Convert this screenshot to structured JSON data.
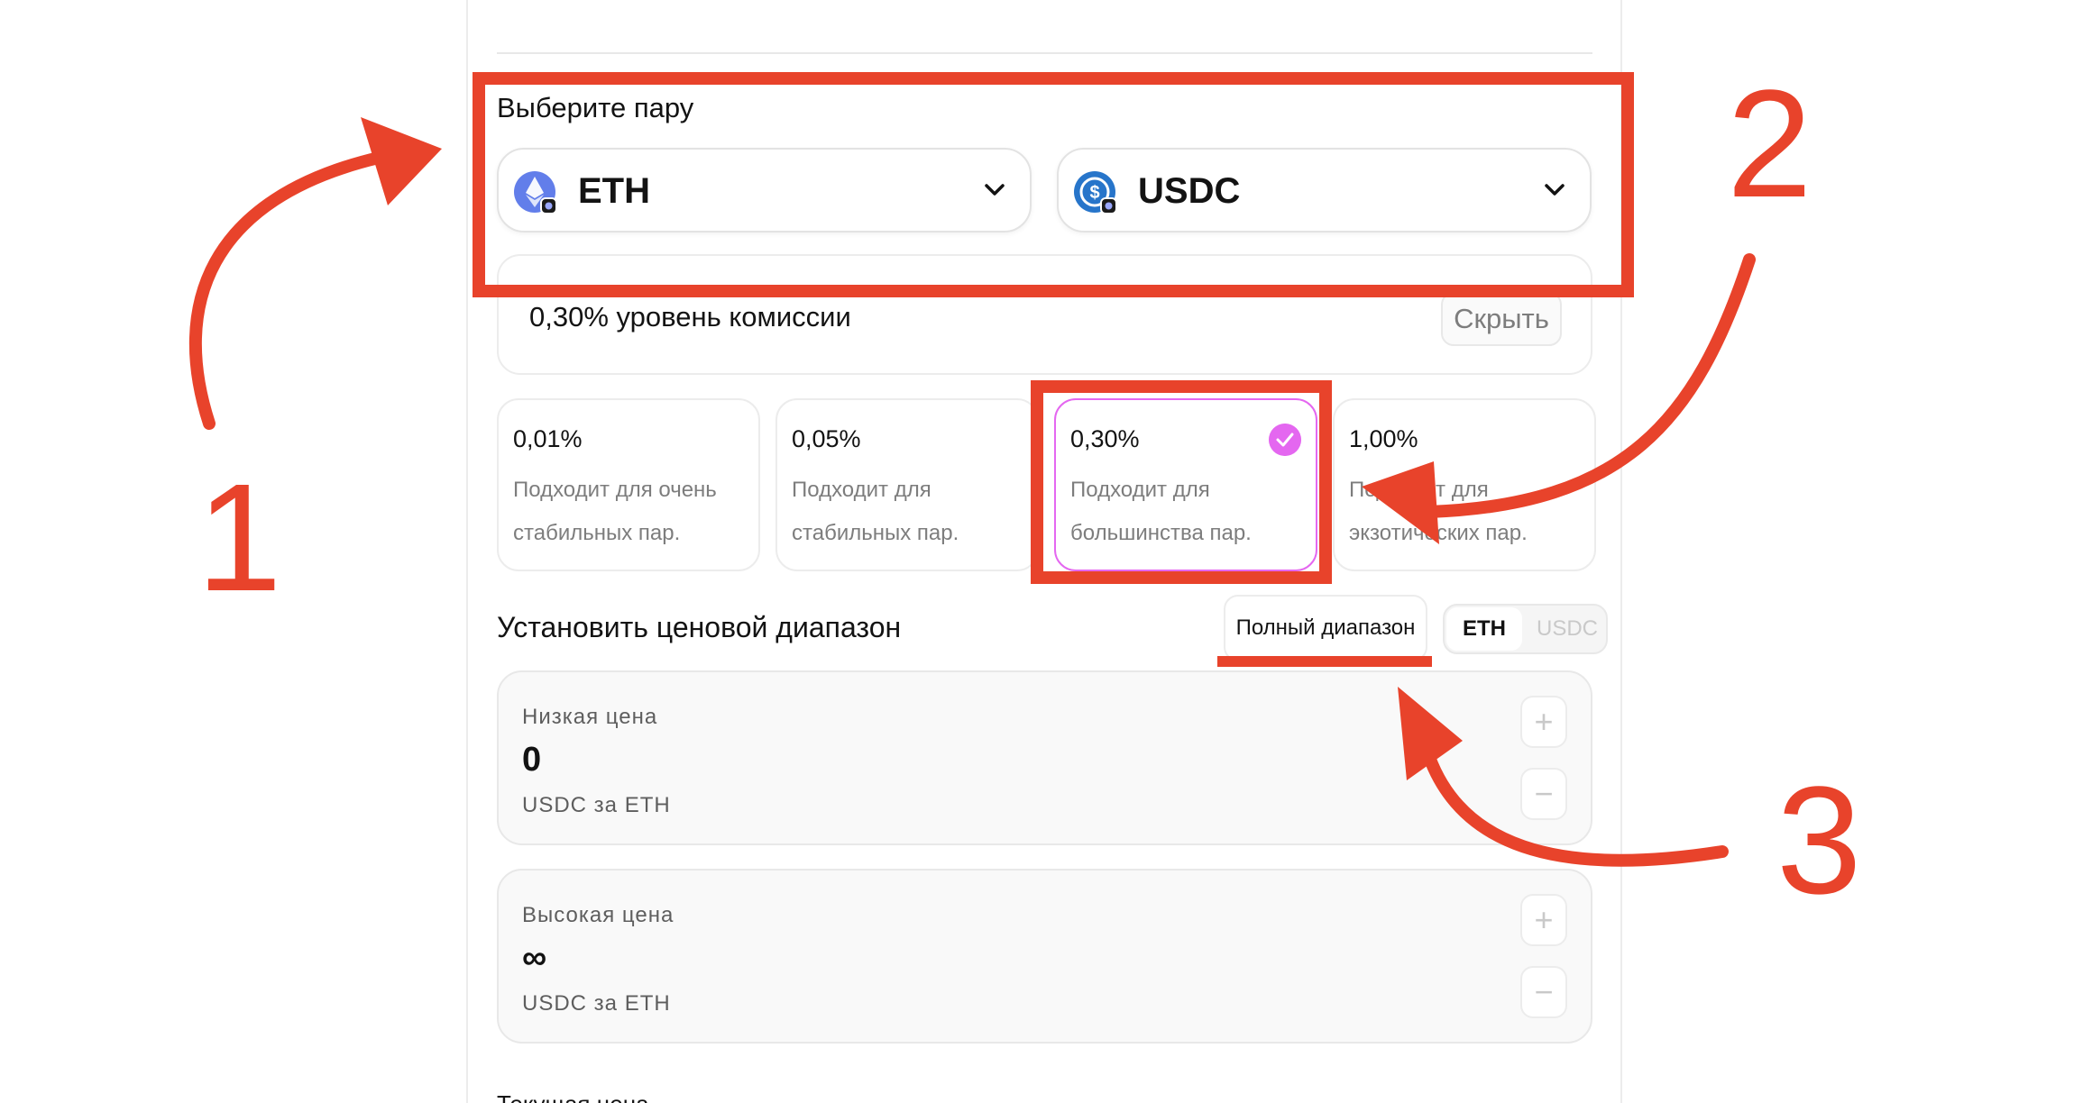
{
  "pair_section": {
    "title": "Выберите пару"
  },
  "token_a": {
    "symbol": "ETH",
    "icon": "eth-token-icon"
  },
  "token_b": {
    "symbol": "USDC",
    "icon": "usdc-token-icon"
  },
  "fee": {
    "summary": "0,30% уровень комиссии",
    "hide_label": "Скрыть"
  },
  "fee_tiers": [
    {
      "pct": "0,01%",
      "desc": "Подходит для очень стабильных пар.",
      "selected": false
    },
    {
      "pct": "0,05%",
      "desc": "Подходит для стабильных пар.",
      "selected": false
    },
    {
      "pct": "0,30%",
      "desc": "Подходит для большинства пар.",
      "selected": true
    },
    {
      "pct": "1,00%",
      "desc": "Подходит для экзотических пар.",
      "selected": false
    }
  ],
  "range": {
    "title": "Установить ценовой диапазон",
    "full_range_label": "Полный диапазон",
    "unit_options": [
      "ETH",
      "USDC"
    ],
    "unit_selected": "ETH"
  },
  "low_price": {
    "label": "Низкая цена",
    "value": "0",
    "unit": "USDC за ETH"
  },
  "high_price": {
    "label": "Высокая цена",
    "value": "∞",
    "unit": "USDC за ETH"
  },
  "stepper": {
    "plus": "+",
    "minus": "−"
  },
  "current_price": {
    "label": "Текущая цена"
  },
  "annotations": {
    "numbers": [
      "1",
      "2",
      "3"
    ],
    "color": "#e8432b"
  },
  "colors": {
    "accent": "#e467f0",
    "eth": "#627eea",
    "usdc": "#2775ca"
  }
}
